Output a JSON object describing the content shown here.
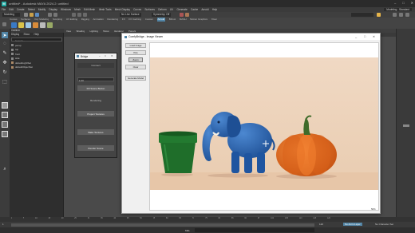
{
  "titlebar": {
    "title": "untitled* - Autodesk MAYA 2024.2: untitled",
    "controls": [
      "–",
      "□",
      "✕"
    ]
  },
  "menubar": {
    "items": [
      "File",
      "Edit",
      "Create",
      "Select",
      "Modify",
      "Display",
      "Windows",
      "Mesh",
      "Edit Mesh",
      "Mesh Tools",
      "Mesh Display",
      "Curves",
      "Surfaces",
      "Deform",
      "UV",
      "Generate",
      "Cache",
      "Arnold",
      "Help"
    ],
    "workspace_value": "Modeling - Standard"
  },
  "statusline": {
    "mode": "Modeling",
    "no_live": "No Live Surface",
    "symmetry": "Symmetry: Off"
  },
  "shelf": {
    "tabs": [
      "Curves",
      "Surfaces",
      "Poly Modeling",
      "Sculpting",
      "UV Editing",
      "Rigging",
      "Animation",
      "Rendering",
      "FX",
      "FX Caching",
      "Custom",
      "Arnold",
      "Bifrost",
      "MASH",
      "Motion Graphics",
      "XGen"
    ],
    "active_tab": "Arnold"
  },
  "outliner": {
    "title": "Outliner",
    "menus": [
      "Display",
      "Show",
      "Help"
    ],
    "search_placeholder": "Search...",
    "items": [
      "persp",
      "top",
      "front",
      "side",
      "defaultLightSet",
      "defaultObjectSet"
    ]
  },
  "viewport": {
    "menus": [
      "View",
      "Shading",
      "Lighting",
      "Show",
      "Renderer",
      "Panels"
    ]
  },
  "bridge": {
    "title": "Bridge",
    "section_connect": "Connect",
    "input_value": "1.00",
    "fill_button": "Fill Scene Button",
    "section_rendering": "Rendering",
    "project_textures": "Project Textures",
    "bake_textures": "Bake Textures",
    "render_scene": "Render Scene"
  },
  "viewer": {
    "title": "ComfyBridge - Image Viewer",
    "sidebar_buttons": [
      "Load Image",
      "Pan",
      "Zoom",
      "Clear"
    ],
    "active_button": "Zoom",
    "generate": "Generate Model",
    "zoom_percent": "50%"
  },
  "timeline": {
    "frames": [
      "1",
      "5",
      "10",
      "15",
      "20",
      "25",
      "30",
      "35",
      "40",
      "45",
      "50",
      "55",
      "60",
      "65",
      "70",
      "75",
      "80",
      "85",
      "90",
      "95",
      "100",
      "105",
      "110",
      "115",
      "120"
    ]
  },
  "commandline": {
    "mode": "MEL",
    "range_start": "1",
    "range_end": "120",
    "playback": "No Anim Layer",
    "char_set": "No Character Set"
  },
  "colors": {
    "maya_panel": "#444444",
    "maya_dark": "#2b2b2b",
    "accent": "#5285a6",
    "window_bg": "#f0f0f0",
    "photo_bg": "#efd6bf",
    "pot": "#1f6e2a",
    "elephant": "#2d68b5",
    "pumpkin": "#e06a1c"
  },
  "icons": {
    "maya_logo": "maya-logo-icon",
    "select_tool": "select-arrow-icon",
    "move_tool": "move-icon",
    "rotate_tool": "rotate-icon",
    "scale_tool": "scale-icon",
    "cursor": "crosshair-cursor-icon"
  }
}
